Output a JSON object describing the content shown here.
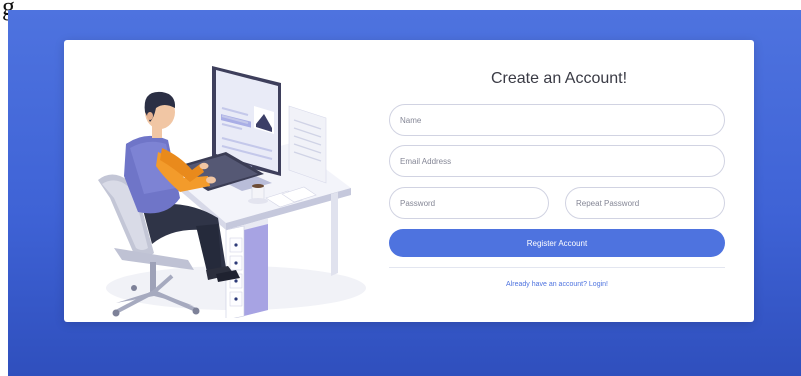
{
  "caption": "g",
  "form": {
    "title": "Create an Account!",
    "name_placeholder": "Name",
    "email_placeholder": "Email Address",
    "password_placeholder": "Password",
    "repeat_password_placeholder": "Repeat Password",
    "register_label": "Register Account",
    "login_link": "Already have an account? Login!"
  },
  "colors": {
    "primary": "#4e73df",
    "background_gradient_end": "#2f4fbd",
    "input_border": "#d1d3e2",
    "heading_text": "#3a3b45"
  },
  "illustration": {
    "subject": "person-working-at-desk-illustration"
  }
}
